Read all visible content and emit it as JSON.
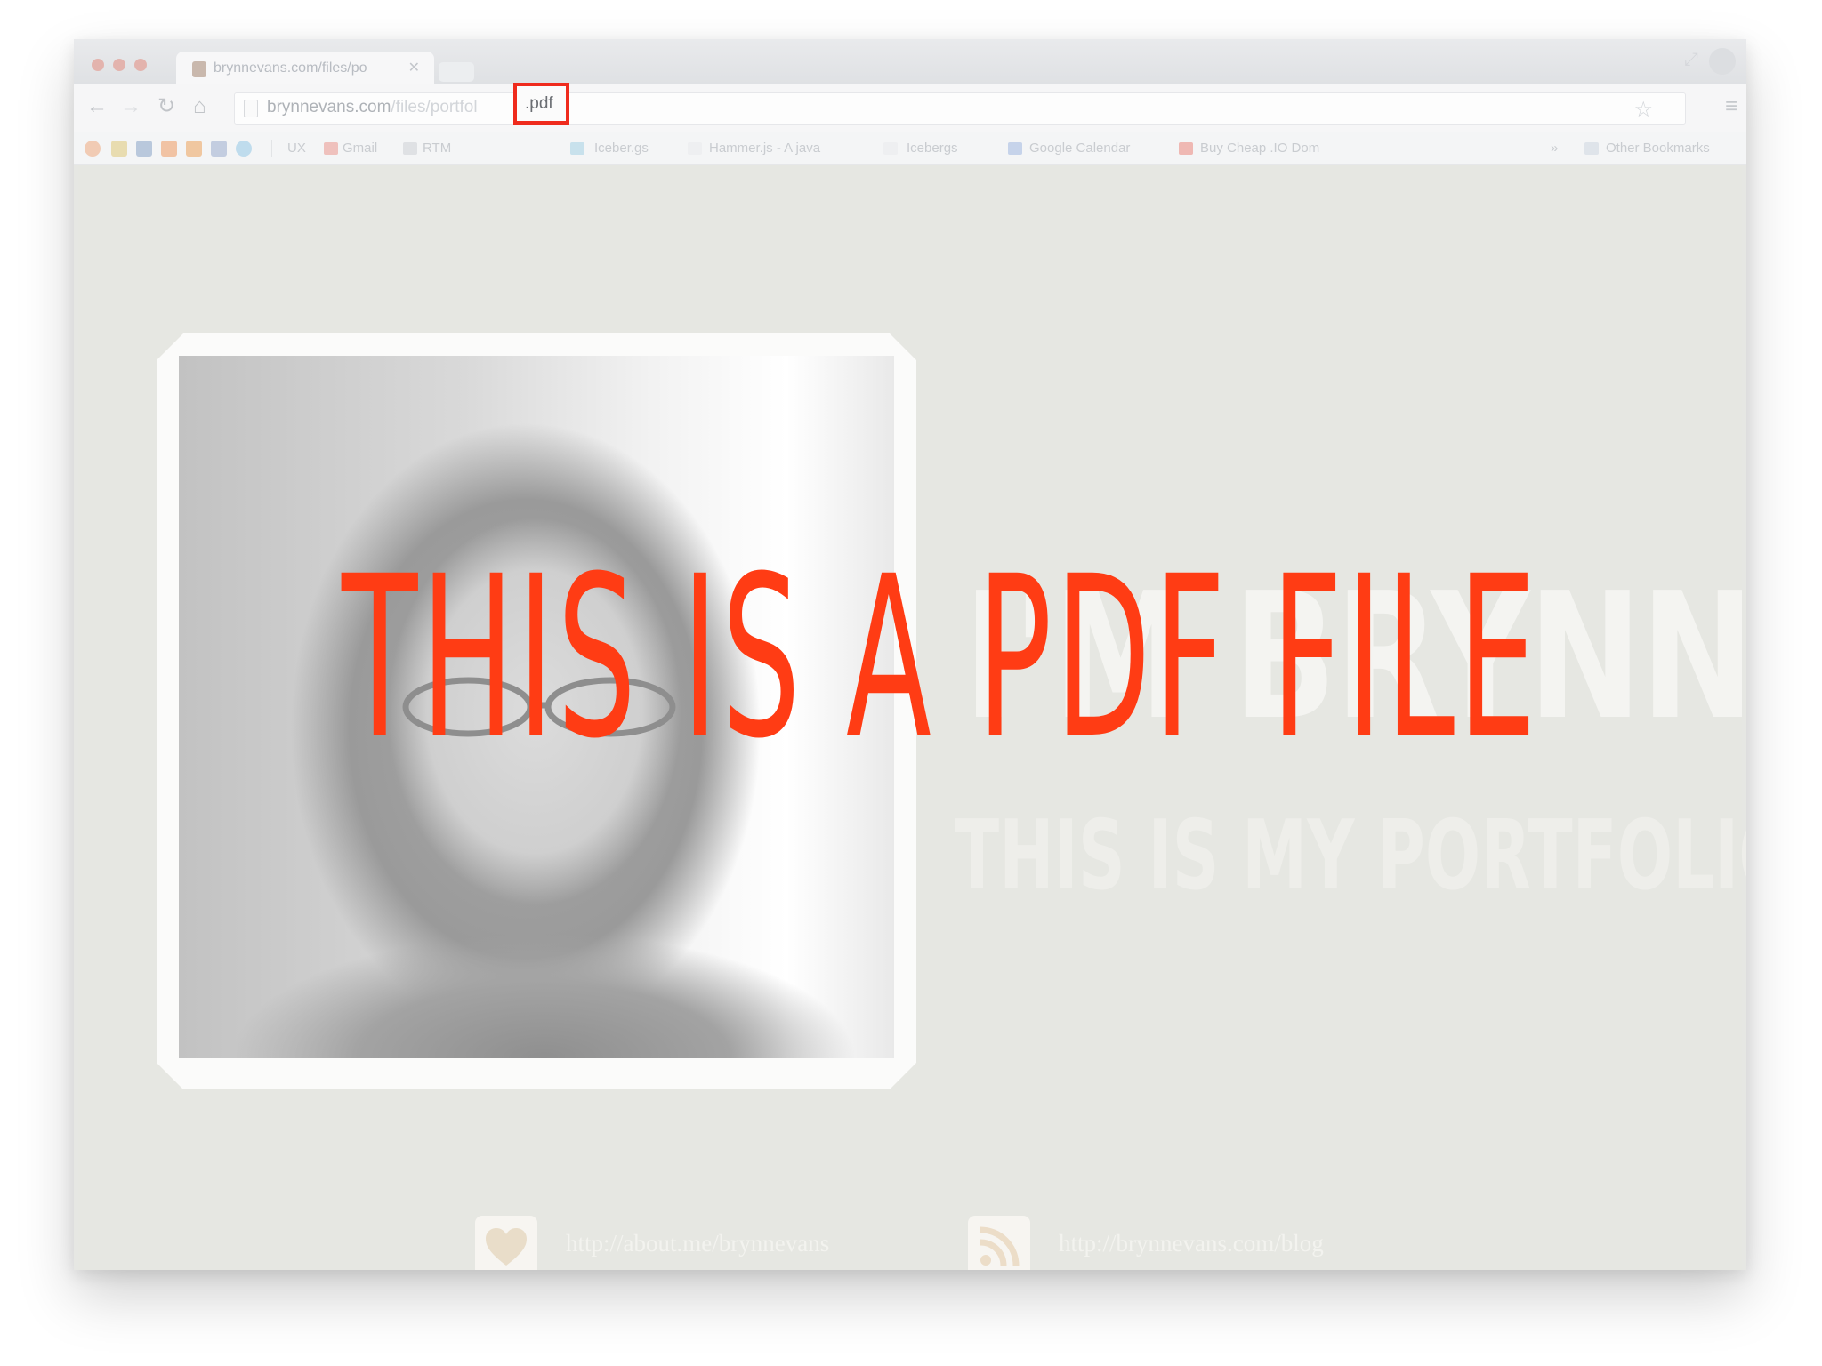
{
  "browser": {
    "tab_title": "brynnevans.com/files/po",
    "url_domain": "brynnevans.com",
    "url_path": "/files/portfol",
    "url_highlight": ".pdf",
    "bookmarks": [
      {
        "label": "UX"
      },
      {
        "label": "Gmail"
      },
      {
        "label": "RTM"
      },
      {
        "label": "Iceber.gs"
      },
      {
        "label": "Hammer.js - A java"
      },
      {
        "label": "Icebergs"
      },
      {
        "label": "Google Calendar"
      },
      {
        "label": "Buy Cheap .IO Dom"
      },
      {
        "label": "Other Bookmarks"
      }
    ]
  },
  "page": {
    "headline": "I'M BRYNN",
    "subheadline": "THIS IS MY PORTFOLIO",
    "links": [
      {
        "icon": "heart-icon",
        "text": "http://about.me/brynnevans"
      },
      {
        "icon": "rss-icon",
        "text": "http://brynnevans.com/blog"
      }
    ]
  },
  "overlay": {
    "text": "THIS IS A PDF FILE"
  },
  "colors": {
    "overlay_text": "#ff3c14",
    "highlight_box": "#ef2b1d",
    "page_background": "#e6e7e2"
  }
}
